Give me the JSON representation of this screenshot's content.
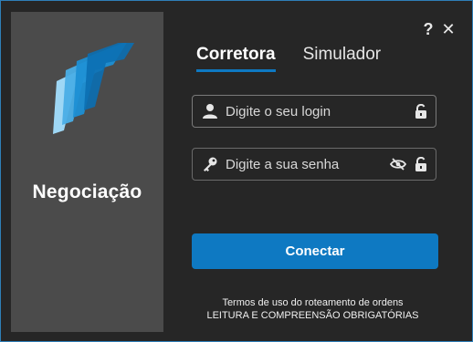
{
  "app": {
    "product_name": "Negociação"
  },
  "window_controls": {
    "help_label": "?",
    "close_label": "✕"
  },
  "tabs": [
    {
      "label": "Corretora",
      "active": true
    },
    {
      "label": "Simulador",
      "active": false
    }
  ],
  "login": {
    "placeholder": "Digite o seu login",
    "value": ""
  },
  "password": {
    "placeholder": "Digite a sua senha",
    "value": ""
  },
  "connect_label": "Conectar",
  "terms": {
    "line1": "Termos de uso do roteamento de ordens",
    "line2": "LEITURA E COMPREENSÃO OBRIGATÓRIAS"
  },
  "icons": {
    "help": "question-icon",
    "close": "close-icon",
    "user": "user-icon",
    "key": "key-icon",
    "lock": "unlock-icon",
    "eye": "eye-slash-icon"
  },
  "colors": {
    "accent": "#0e79c2",
    "border": "#2f7fb8",
    "panel": "#4b4b4b",
    "background": "#262626"
  }
}
